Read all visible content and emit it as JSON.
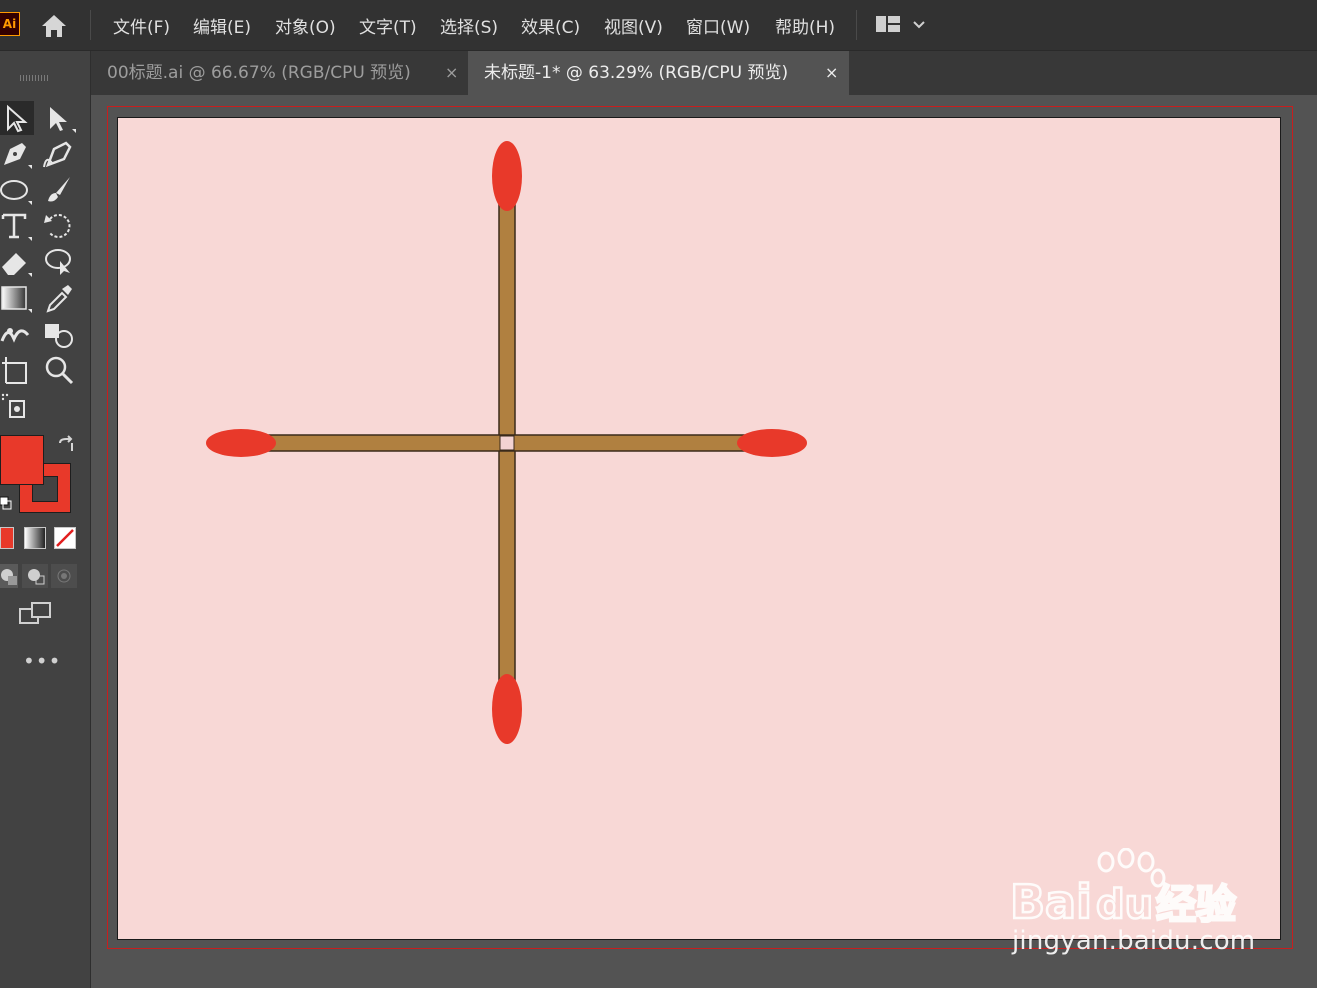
{
  "app": {
    "logo_text": "Ai"
  },
  "menu": {
    "items": [
      "文件(F)",
      "编辑(E)",
      "对象(O)",
      "文字(T)",
      "选择(S)",
      "效果(C)",
      "视图(V)",
      "窗口(W)",
      "帮助(H)"
    ]
  },
  "tabs": [
    {
      "label": "00标题.ai @ 66.67% (RGB/CPU 预览)",
      "close": "×",
      "active": false
    },
    {
      "label": "未标题-1* @ 63.29% (RGB/CPU 预览)",
      "close": "×",
      "active": true
    }
  ],
  "toolbar": {
    "more_label": "•••"
  },
  "colors": {
    "fill": "#e8392a",
    "stroke": "#e8392a",
    "artboard_bg": "#f8d8d6",
    "match_stick": "#b08040",
    "match_head": "#e8392a"
  },
  "artwork": {
    "shape": "four matches forming a cross"
  },
  "watermark": {
    "logo_text": "Bai du 经验",
    "url": "jingyan.baidu.com"
  }
}
